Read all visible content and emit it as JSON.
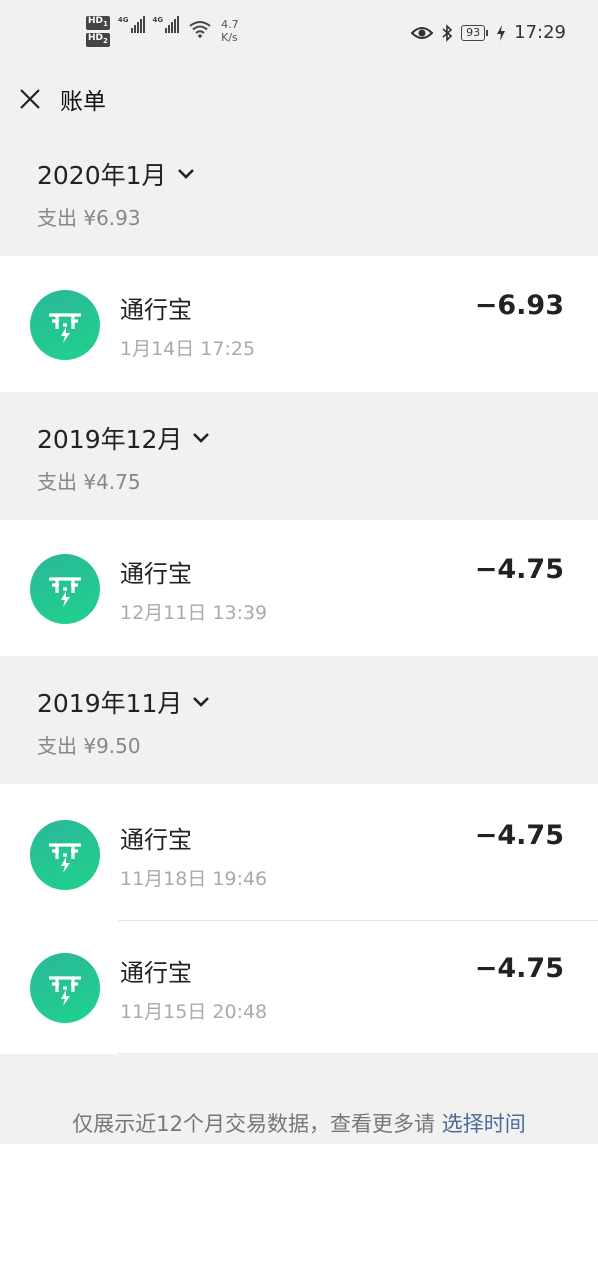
{
  "status_bar": {
    "hd1": "HD",
    "hd1_sub": "1",
    "hd2": "HD",
    "hd2_sub": "2",
    "signal1_label": "4G",
    "signal2_label": "4G",
    "net_speed_value": "4.7",
    "net_speed_unit": "K/s",
    "battery": "93",
    "time": "17:29",
    "icons": [
      "eye-icon",
      "bluetooth-icon",
      "battery-icon",
      "charging-icon",
      "wifi-icon",
      "signal-icon"
    ]
  },
  "nav": {
    "title": "账单",
    "close_icon": "close-icon"
  },
  "months": [
    {
      "title": "2020年1月",
      "summary": "支出 ¥6.93"
    },
    {
      "title": "2019年12月",
      "summary": "支出 ¥4.75"
    },
    {
      "title": "2019年11月",
      "summary": "支出 ¥9.50"
    }
  ],
  "transactions": [
    {
      "name": "通行宝",
      "time": "1月14日 17:25",
      "amount": "−6.93"
    },
    {
      "name": "通行宝",
      "time": "12月11日 13:39",
      "amount": "−4.75"
    },
    {
      "name": "通行宝",
      "time": "11月18日 19:46",
      "amount": "−4.75"
    },
    {
      "name": "通行宝",
      "time": "11月15日 20:48",
      "amount": "−4.75"
    }
  ],
  "footer": {
    "text": "仅展示近12个月交易数据，查看更多请",
    "link": "选择时间"
  },
  "colors": {
    "header_bg": "#f1f1f1",
    "icon_gradient_start": "#2bb79a",
    "icon_gradient_end": "#1fd28c",
    "link": "#4a6a98"
  }
}
